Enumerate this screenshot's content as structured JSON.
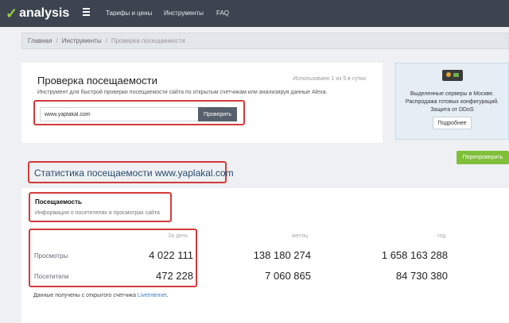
{
  "header": {
    "logo_check": "✓",
    "logo_text": "analysis",
    "nav": [
      "Тарифы и цены",
      "Инструменты",
      "FAQ"
    ]
  },
  "breadcrumb": {
    "items": [
      "Главная",
      "Инструменты"
    ],
    "current": "Проверка посещаемости",
    "separator": "/"
  },
  "checker": {
    "title": "Проверка посещаемости",
    "usage": "Использовано 1 из 5 в сутки",
    "description": "Инструмент для быстрой проверки посещаемости сайта по открытым счетчикам или анализируя данные Alexa.",
    "input_value": "www.yaplakal.com",
    "button": "Проверить"
  },
  "ad": {
    "text": "Выделенные серверы в Москве. Распродажа готовых конфигураций. Защита от DDoS",
    "button": "Подробнее"
  },
  "recheck_button": "Перепроверить",
  "stats": {
    "title": "Статистика посещаемости www.yaplakal.com",
    "section_title": "Посещаемость",
    "section_desc": "Информация о посетителях и просмотрах сайта",
    "columns": [
      "За день",
      "месяц",
      "год"
    ],
    "rows": [
      {
        "label": "Просмотры",
        "values": [
          "4 022 111",
          "138 180 274",
          "1 658 163 288"
        ]
      },
      {
        "label": "Посетители",
        "values": [
          "472 228",
          "7 060 865",
          "84 730 380"
        ]
      }
    ],
    "note_prefix": "Данные получены с открытого счетчика",
    "note_link": "LiveInternet",
    "note_suffix": "."
  },
  "colors": {
    "topbar": "#3d4450",
    "logo_check": "#9bd53c",
    "highlight": "#d33a3a",
    "recheck": "#7fbf3a",
    "link": "#3a7bbf"
  }
}
